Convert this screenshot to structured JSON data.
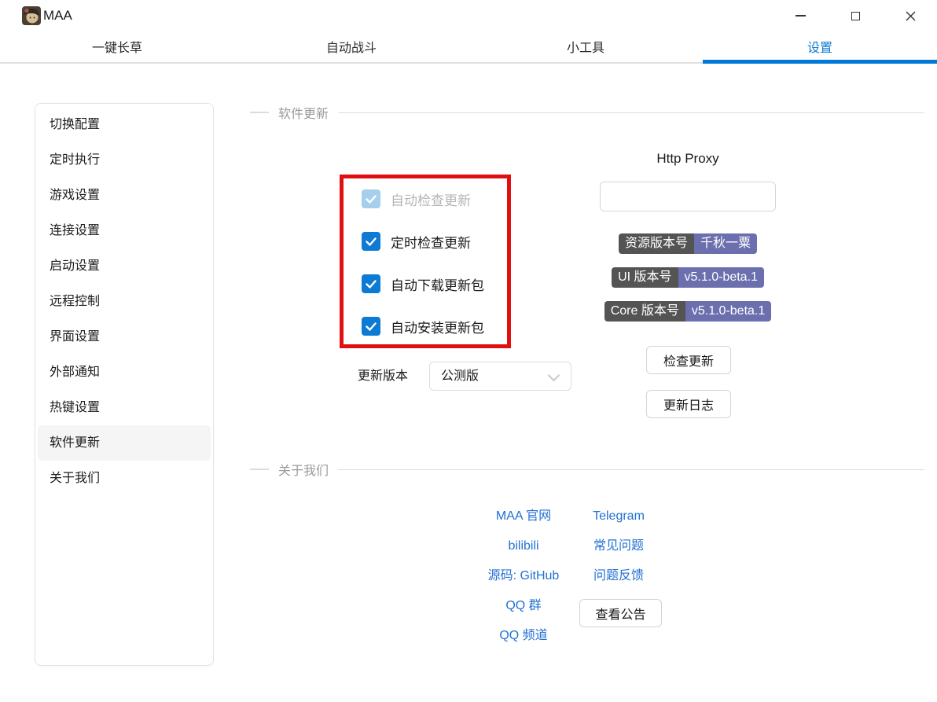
{
  "app": {
    "title": "MAA"
  },
  "icons": {
    "minimize": "–",
    "maximize": "□",
    "close": "✕",
    "chevron_down": "∨",
    "checkmark": "✓"
  },
  "tabs": {
    "items": [
      {
        "label": "一键长草"
      },
      {
        "label": "自动战斗"
      },
      {
        "label": "小工具"
      },
      {
        "label": "设置"
      }
    ],
    "active_index": 3
  },
  "sidebar": {
    "items": [
      {
        "label": "切换配置"
      },
      {
        "label": "定时执行"
      },
      {
        "label": "游戏设置"
      },
      {
        "label": "连接设置"
      },
      {
        "label": "启动设置"
      },
      {
        "label": "远程控制"
      },
      {
        "label": "界面设置"
      },
      {
        "label": "外部通知"
      },
      {
        "label": "热键设置"
      },
      {
        "label": "软件更新"
      },
      {
        "label": "关于我们"
      }
    ],
    "active_index": 9
  },
  "sections": {
    "software_update_title": "软件更新",
    "about_title": "关于我们"
  },
  "software_update": {
    "checkboxes": [
      {
        "label": "自动检查更新",
        "checked": true,
        "disabled": true
      },
      {
        "label": "定时检查更新",
        "checked": true,
        "disabled": false
      },
      {
        "label": "自动下载更新包",
        "checked": true,
        "disabled": false
      },
      {
        "label": "自动安装更新包",
        "checked": true,
        "disabled": false
      }
    ],
    "update_channel": {
      "label": "更新版本",
      "value": "公测版"
    },
    "http_proxy": {
      "label": "Http Proxy",
      "value": "",
      "placeholder": ""
    },
    "version_badges": [
      {
        "key": "资源版本号",
        "value": "千秋一粟"
      },
      {
        "key": "UI 版本号",
        "value": "v5.1.0-beta.1"
      },
      {
        "key": "Core 版本号",
        "value": "v5.1.0-beta.1"
      }
    ],
    "check_update_button": "检查更新",
    "changelog_button": "更新日志"
  },
  "about": {
    "links_left": [
      {
        "label": "MAA 官网"
      },
      {
        "label": "bilibili"
      },
      {
        "label": "源码: GitHub"
      },
      {
        "label": "QQ 群"
      },
      {
        "label": "QQ 频道"
      }
    ],
    "links_right": [
      {
        "label": "Telegram"
      },
      {
        "label": "常见问题"
      },
      {
        "label": "问题反馈"
      }
    ],
    "announcement_button": "查看公告"
  },
  "colors": {
    "accent_blue": "#0d7ad4",
    "tab_underline": "#0078d7",
    "link_blue": "#2270d3",
    "badge_gray": "#545454",
    "badge_purple": "#6b6fad",
    "annotation_red": "#e01010",
    "disabled_checkbox": "#a5cfec"
  }
}
